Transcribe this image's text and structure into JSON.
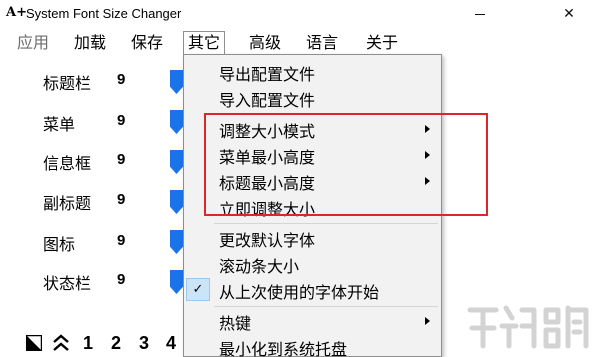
{
  "window": {
    "title": "System Font Size Changer",
    "app_icon_glyph": "A+",
    "minimize_icon": "minimize-icon",
    "close_glyph": "✕"
  },
  "menubar": [
    {
      "label": "应用",
      "disabled": true
    },
    {
      "label": "加载",
      "disabled": false
    },
    {
      "label": "保存",
      "disabled": false
    },
    {
      "label": "其它",
      "disabled": false,
      "open": true
    },
    {
      "label": "高级",
      "disabled": false
    },
    {
      "label": "语言",
      "disabled": false
    },
    {
      "label": "关于",
      "disabled": false
    }
  ],
  "rows": [
    {
      "label": "标题栏",
      "value": "9"
    },
    {
      "label": "菜单",
      "value": "9"
    },
    {
      "label": "信息框",
      "value": "9"
    },
    {
      "label": "副标题",
      "value": "9"
    },
    {
      "label": "图标",
      "value": "9"
    },
    {
      "label": "状态栏",
      "value": "9"
    }
  ],
  "bottom_bar": {
    "icons": [
      "resize-corner-icon",
      "double-chevron-up-icon"
    ],
    "numbers": [
      "1",
      "2",
      "3",
      "4"
    ]
  },
  "dropdown": {
    "items": [
      {
        "label": "导出配置文件",
        "submenu": false,
        "checked": false
      },
      {
        "label": "导入配置文件",
        "submenu": false,
        "checked": false
      },
      {
        "label": "调整大小模式",
        "submenu": true,
        "checked": false
      },
      {
        "label": "菜单最小高度",
        "submenu": true,
        "checked": false
      },
      {
        "label": "标题最小高度",
        "submenu": true,
        "checked": false
      },
      {
        "label": "立即调整大小",
        "submenu": false,
        "checked": false
      },
      {
        "label": "更改默认字体",
        "submenu": false,
        "checked": false
      },
      {
        "label": "滚动条大小",
        "submenu": false,
        "checked": false
      },
      {
        "label": "从上次使用的字体开始",
        "submenu": false,
        "checked": true
      },
      {
        "label": "热键",
        "submenu": true,
        "checked": false
      },
      {
        "label": "最小化到系统托盘",
        "submenu": false,
        "checked": false
      }
    ],
    "check_glyph": "✓"
  },
  "colors": {
    "slider_thumb": "#1a73e8",
    "highlight_box": "#e0242b",
    "menu_background": "#f2f2f2"
  }
}
